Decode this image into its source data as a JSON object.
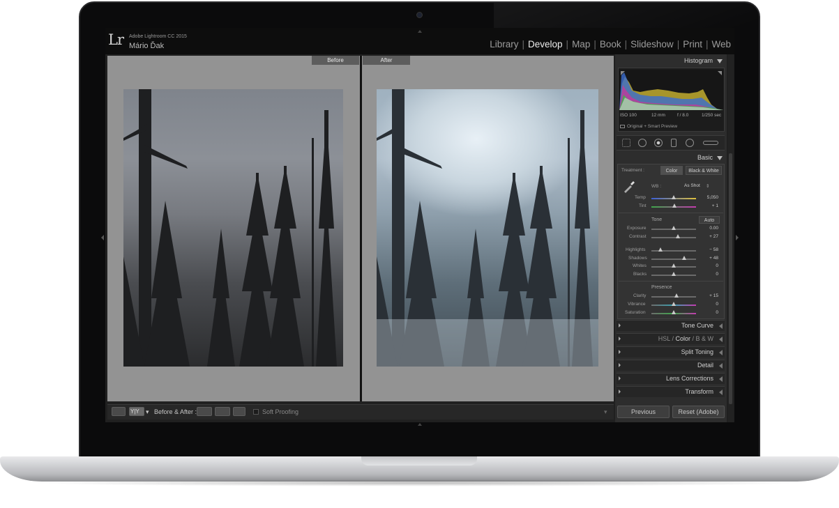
{
  "header": {
    "logo": "Lr",
    "app_name": "Adobe Lightroom CC 2015",
    "user": "Mário Ďak",
    "modules": [
      "Library",
      "Develop",
      "Map",
      "Book",
      "Slideshow",
      "Print",
      "Web"
    ],
    "active_module": "Develop"
  },
  "view": {
    "before_label": "Before",
    "after_label": "After"
  },
  "toolbar": {
    "yy_label": "Y|Y",
    "before_after_label": "Before & After :",
    "soft_proofing": "Soft Proofing"
  },
  "histogram": {
    "title": "Histogram",
    "iso": "ISO 100",
    "focal": "12 mm",
    "aperture": "f / 8.0",
    "shutter": "1/250 sec",
    "preview": "Original + Smart Preview"
  },
  "basic": {
    "title": "Basic",
    "treatment_label": "Treatment :",
    "color_btn": "Color",
    "bw_btn": "Black & White",
    "wb_label": "WB :",
    "wb_value": "As Shot",
    "temp_label": "Temp",
    "temp_value": "5,050",
    "tint_label": "Tint",
    "tint_value": "+ 1",
    "tone_label": "Tone",
    "auto_label": "Auto",
    "exposure_label": "Exposure",
    "exposure_value": "0.00",
    "contrast_label": "Contrast",
    "contrast_value": "+ 27",
    "highlights_label": "Highlights",
    "highlights_value": "− 58",
    "shadows_label": "Shadows",
    "shadows_value": "+ 48",
    "whites_label": "Whites",
    "whites_value": "0",
    "blacks_label": "Blacks",
    "blacks_value": "0",
    "presence_label": "Presence",
    "clarity_label": "Clarity",
    "clarity_value": "+ 15",
    "vibrance_label": "Vibrance",
    "vibrance_value": "0",
    "saturation_label": "Saturation",
    "saturation_value": "0"
  },
  "panels": {
    "tone_curve": "Tone Curve",
    "hsl": "HSL",
    "color": "Color",
    "bw": "B & W",
    "split_toning": "Split Toning",
    "detail": "Detail",
    "lens_corrections": "Lens Corrections",
    "transform": "Transform"
  },
  "buttons": {
    "previous": "Previous",
    "reset": "Reset (Adobe)"
  },
  "sliders": {
    "temp": 0.5,
    "tint": 0.52,
    "exposure": 0.5,
    "contrast": 0.6,
    "highlights": 0.21,
    "shadows": 0.74,
    "whites": 0.5,
    "blacks": 0.5,
    "clarity": 0.57,
    "vibrance": 0.5,
    "saturation": 0.5
  }
}
